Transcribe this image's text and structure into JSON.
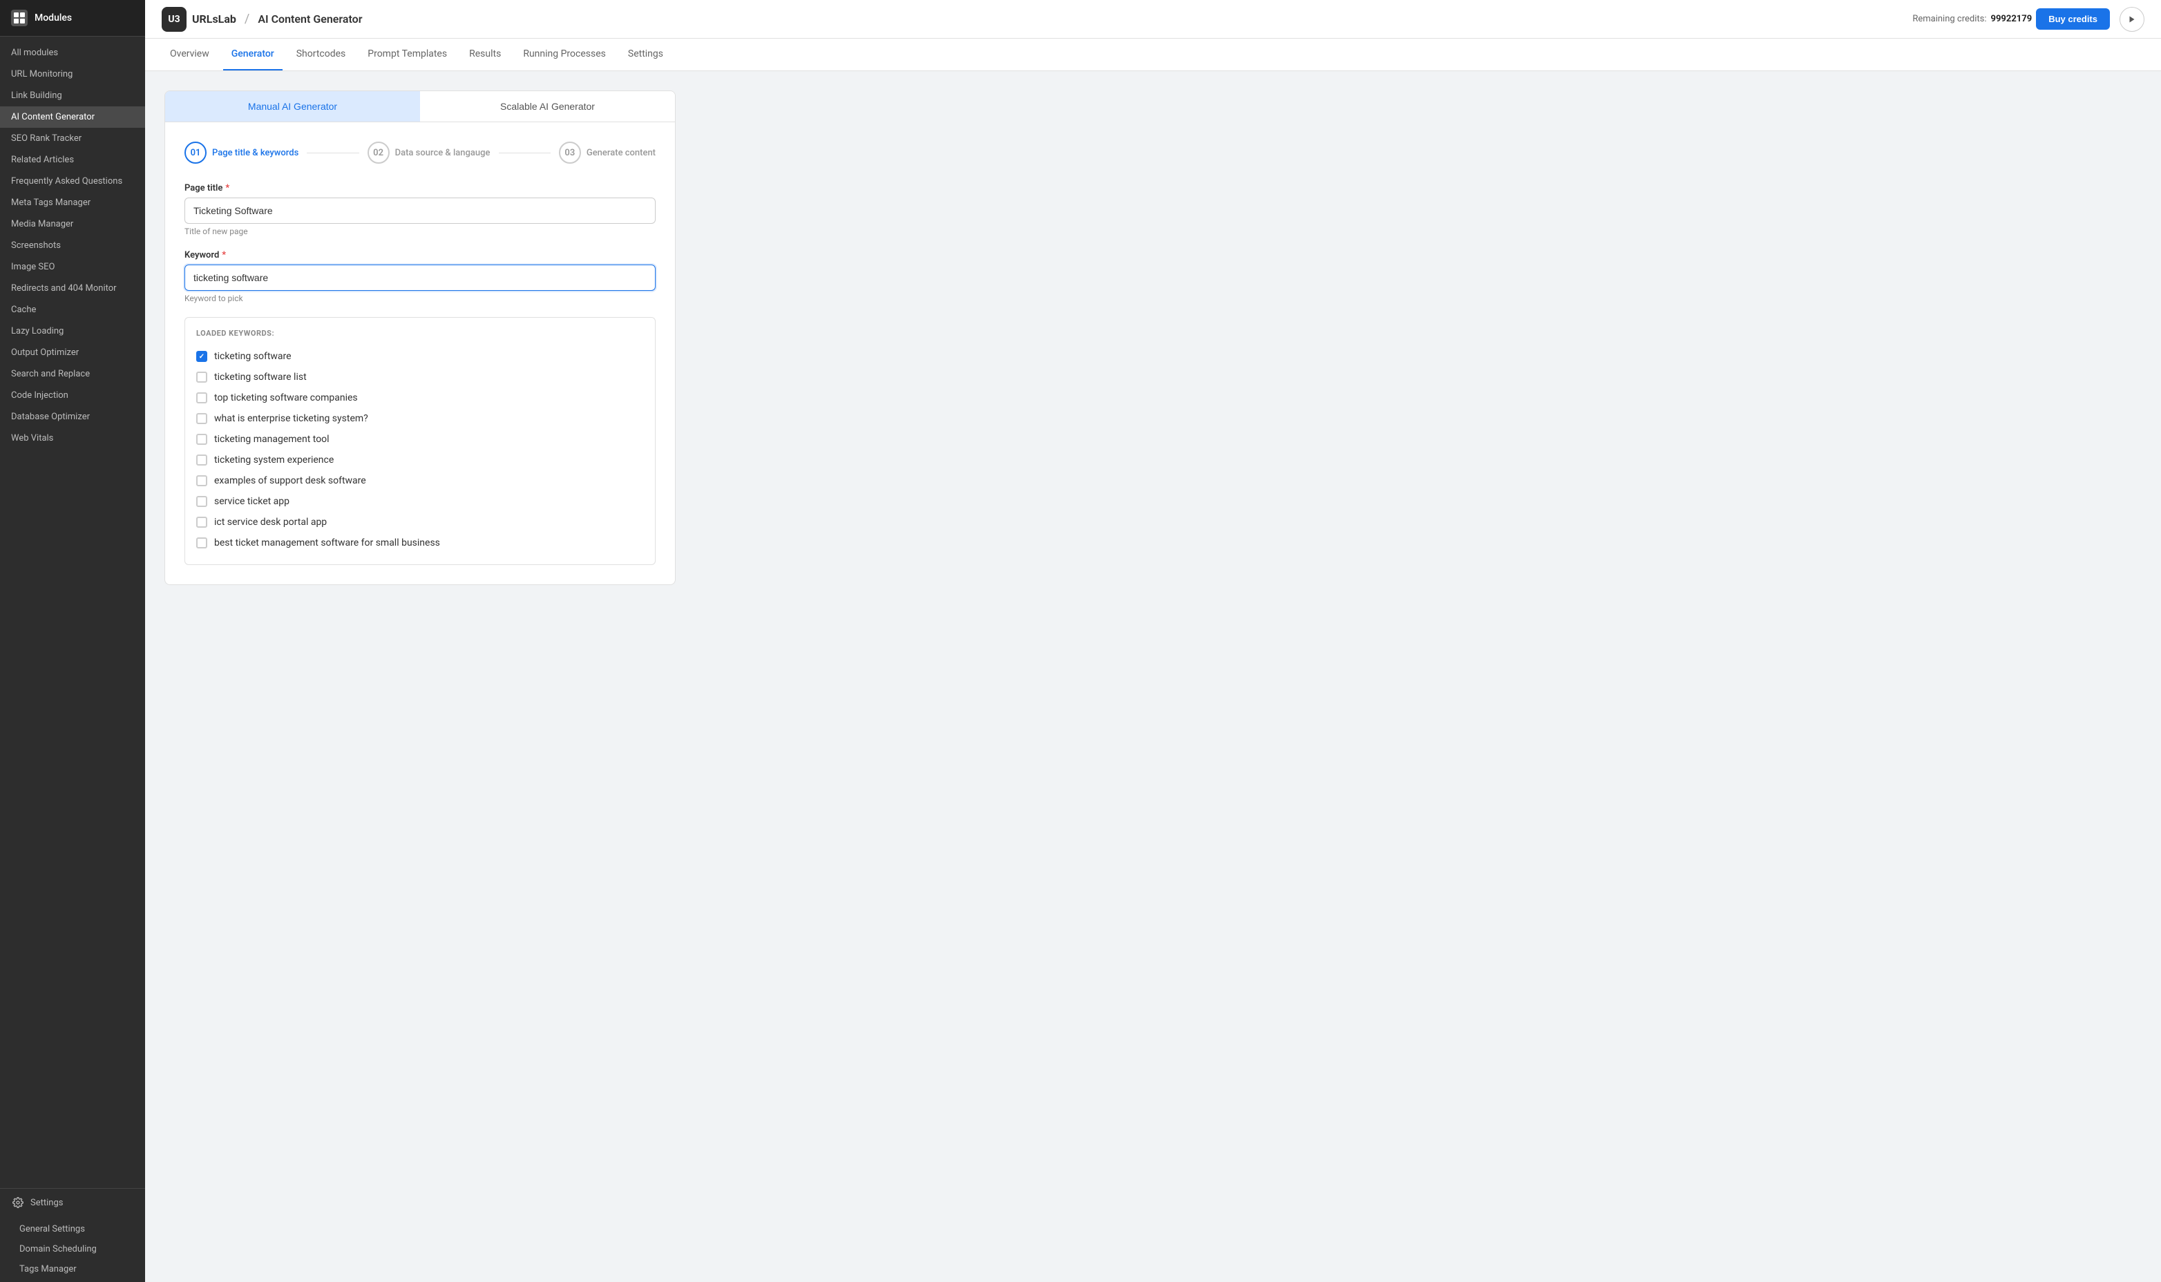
{
  "app": {
    "logo_text": "U3",
    "logo_brand": "URLsLab",
    "separator": "/",
    "page_title": "AI Content Generator",
    "credits_label": "Remaining credits:",
    "credits_value": "99922179",
    "buy_credits_label": "Buy credits"
  },
  "sidebar": {
    "top_label": "Modules",
    "items": [
      {
        "id": "all-modules",
        "label": "All modules",
        "active": false
      },
      {
        "id": "url-monitoring",
        "label": "URL Monitoring",
        "active": false
      },
      {
        "id": "link-building",
        "label": "Link Building",
        "active": false
      },
      {
        "id": "ai-content-generator",
        "label": "AI Content Generator",
        "active": true
      },
      {
        "id": "seo-rank-tracker",
        "label": "SEO Rank Tracker",
        "active": false
      },
      {
        "id": "related-articles",
        "label": "Related Articles",
        "active": false
      },
      {
        "id": "faq",
        "label": "Frequently Asked Questions",
        "active": false
      },
      {
        "id": "meta-tags-manager",
        "label": "Meta Tags Manager",
        "active": false
      },
      {
        "id": "media-manager",
        "label": "Media Manager",
        "active": false
      },
      {
        "id": "screenshots",
        "label": "Screenshots",
        "active": false
      },
      {
        "id": "image-seo",
        "label": "Image SEO",
        "active": false
      },
      {
        "id": "redirects-404",
        "label": "Redirects and 404 Monitor",
        "active": false
      },
      {
        "id": "cache",
        "label": "Cache",
        "active": false
      },
      {
        "id": "lazy-loading",
        "label": "Lazy Loading",
        "active": false
      },
      {
        "id": "output-optimizer",
        "label": "Output Optimizer",
        "active": false
      },
      {
        "id": "search-replace",
        "label": "Search and Replace",
        "active": false
      },
      {
        "id": "code-injection",
        "label": "Code Injection",
        "active": false
      },
      {
        "id": "database-optimizer",
        "label": "Database Optimizer",
        "active": false
      },
      {
        "id": "web-vitals",
        "label": "Web Vitals",
        "active": false
      }
    ],
    "settings_label": "Settings",
    "sub_items": [
      {
        "id": "general-settings",
        "label": "General Settings"
      },
      {
        "id": "domain-scheduling",
        "label": "Domain Scheduling"
      },
      {
        "id": "tags-manager",
        "label": "Tags Manager"
      }
    ]
  },
  "nav_tabs": [
    {
      "id": "overview",
      "label": "Overview",
      "active": false
    },
    {
      "id": "generator",
      "label": "Generator",
      "active": true
    },
    {
      "id": "shortcodes",
      "label": "Shortcodes",
      "active": false
    },
    {
      "id": "prompt-templates",
      "label": "Prompt Templates",
      "active": false
    },
    {
      "id": "results",
      "label": "Results",
      "active": false
    },
    {
      "id": "running-processes",
      "label": "Running Processes",
      "active": false
    },
    {
      "id": "settings",
      "label": "Settings",
      "active": false
    }
  ],
  "generator_tabs": [
    {
      "id": "manual",
      "label": "Manual AI Generator",
      "active": true
    },
    {
      "id": "scalable",
      "label": "Scalable AI Generator",
      "active": false
    }
  ],
  "steps": [
    {
      "id": "step1",
      "number": "01",
      "label": "Page title & keywords",
      "active": true
    },
    {
      "id": "step2",
      "number": "02",
      "label": "Data source & langauge",
      "active": false
    },
    {
      "id": "step3",
      "number": "03",
      "label": "Generate content",
      "active": false
    }
  ],
  "form": {
    "page_title_label": "Page title",
    "page_title_required": true,
    "page_title_value": "Ticketing Software",
    "page_title_hint": "Title of new page",
    "keyword_label": "Keyword",
    "keyword_required": true,
    "keyword_value": "ticketing software",
    "keyword_hint": "Keyword to pick",
    "loaded_keywords_label": "LOADED KEYWORDS:",
    "keywords": [
      {
        "id": "kw1",
        "text": "ticketing software",
        "checked": true
      },
      {
        "id": "kw2",
        "text": "ticketing software list",
        "checked": false
      },
      {
        "id": "kw3",
        "text": "top ticketing software companies",
        "checked": false
      },
      {
        "id": "kw4",
        "text": "what is enterprise ticketing system?",
        "checked": false
      },
      {
        "id": "kw5",
        "text": "ticketing management tool",
        "checked": false
      },
      {
        "id": "kw6",
        "text": "ticketing system experience",
        "checked": false
      },
      {
        "id": "kw7",
        "text": "examples of support desk software",
        "checked": false
      },
      {
        "id": "kw8",
        "text": "service ticket app",
        "checked": false
      },
      {
        "id": "kw9",
        "text": "ict service desk portal app",
        "checked": false
      },
      {
        "id": "kw10",
        "text": "best ticket management software for small business",
        "checked": false
      }
    ]
  }
}
